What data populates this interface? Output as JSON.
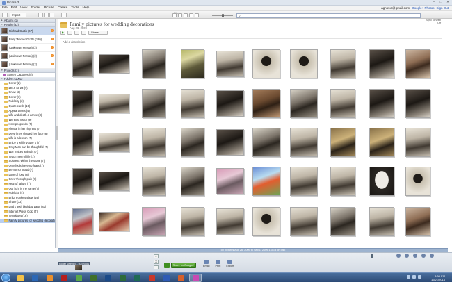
{
  "window": {
    "title": "Picasa 3",
    "controls": [
      "–",
      "□",
      "✕"
    ]
  },
  "menu": {
    "items": [
      "File",
      "Edit",
      "View",
      "Folder",
      "Picture",
      "Create",
      "Tools",
      "Help"
    ],
    "user_email": "agnieka@gmail.com",
    "sign_in_label": "Google+ Photos",
    "sign_out_label": "Sign Out"
  },
  "toolbar": {
    "import_label": "Import",
    "filters_label": "Filters",
    "search_placeholder": ""
  },
  "sidebar": {
    "sections": {
      "albums": "Albums (1)",
      "people": "People (32)",
      "projects": "Projects (1)",
      "folders": "Folders (1001)"
    },
    "people": [
      {
        "name": "Richard Curtis (67)",
        "badge": "!"
      },
      {
        "name": "Baby Werner Grotto (120)",
        "badge": "!"
      },
      {
        "name": "(Unknown Person) (2)",
        "badge": "!"
      },
      {
        "name": "(Unknown Person) (2)",
        "badge": "!"
      },
      {
        "name": "(Unknown Person) (2)",
        "badge": "!"
      }
    ],
    "project_item": "Screen Captures (8)",
    "folders": [
      "Cover (2)",
      "2014-12-23 (7)",
      "Snow (2)",
      "Cover (1)",
      "Publicity (2)",
      "Quote cards (10)",
      "Appearances (4)",
      "Life and death a dance (8)",
      "We exist touch (9)",
      "How people do (7)",
      "Please in her rhythms (7)",
      "Deep lines shaped her face (8)",
      "Life is a lesson (7)",
      "Enjoy it while you're it (7)",
      "Only Man can be thoughtful (7)",
      "War makes animals (7)",
      "Teach men of life (7)",
      "Softness within the stone (7)",
      "Only fools have no fears (7)",
      "Be not so proud (7)",
      "Love of food (8)",
      "Grow through pain (7)",
      "Fear of failure (7)",
      "Our light is the same (7)",
      "Publicity (4)",
      "Erika Funke's show (26)",
      "Share (12)",
      "Dad's 80th birthday party (83)",
      "Internet Press Gold (7)",
      "Templates (16)",
      "Family pictures for wedding decorations"
    ],
    "selected_folder_index": 30
  },
  "album": {
    "title": "Family pictures for wedding decorations",
    "date": "Aug 26, 2009",
    "share_label": "Share",
    "add_description": "Add a description",
    "sync_label": "Sync to Web",
    "sync_state": "Off"
  },
  "thumbnails": [
    "ph-a",
    "ph-b",
    "ph-a",
    "ph-f",
    "ph-c",
    "ph-d",
    "ph-d",
    "ph-c",
    "ph-b",
    "ph-l",
    "ph-b",
    "ph-c",
    "ph-a",
    "ph-c",
    "ph-b",
    "ph-e",
    "ph-a",
    "ph-c",
    "ph-b",
    "ph-b",
    "ph-b",
    "ph-c",
    "ph-c",
    "ph-a",
    "ph-b",
    "ph-a",
    "ph-c",
    "ph-k",
    "ph-k",
    "ph-c",
    "ph-b",
    "ph-b",
    "ph-c",
    "ph-a",
    "ph-g",
    "ph-h",
    "ph-c",
    "ph-c",
    "ph-m",
    "ph-d",
    "ph-i",
    "ph-j",
    "ph-g",
    "ph-c",
    "ph-c",
    "ph-d",
    "ph-c",
    "ph-a",
    "ph-c",
    "ph-l"
  ],
  "status_bar": "50 pictures   Aug 26, 2009 to Sep 1, 2009   1.3GB on disk",
  "tray": {
    "selection_label": "Folder Selected - 50 photos",
    "share_button": "Share on Google+",
    "actions": [
      "Email",
      "Print",
      "Export"
    ]
  },
  "taskbar": {
    "apps": [
      {
        "icon": "windows-explorer-icon",
        "color": "#f3c149"
      },
      {
        "icon": "outlook-icon",
        "color": "#2b67b5"
      },
      {
        "icon": "media-icon",
        "color": "#e98f2d"
      },
      {
        "icon": "acrobat-icon",
        "color": "#b61f1f"
      },
      {
        "icon": "chrome-icon",
        "color": "#5aa84a"
      },
      {
        "icon": "dreamweaver-icon",
        "color": "#3f6f2a"
      },
      {
        "icon": "photoshop-icon",
        "color": "#1b4a88"
      },
      {
        "icon": "dreamweaver2-icon",
        "color": "#2e6b3a"
      },
      {
        "icon": "audition-icon",
        "color": "#1f6b54"
      },
      {
        "icon": "acrobat2-icon",
        "color": "#c9382a"
      },
      {
        "icon": "word-icon",
        "color": "#2f5bb5"
      },
      {
        "icon": "firefox-icon",
        "color": "#d4602c"
      },
      {
        "icon": "picasa-icon",
        "color": "#c94ab3"
      }
    ],
    "time": "3:38 PM",
    "date": "12/21/2014"
  }
}
